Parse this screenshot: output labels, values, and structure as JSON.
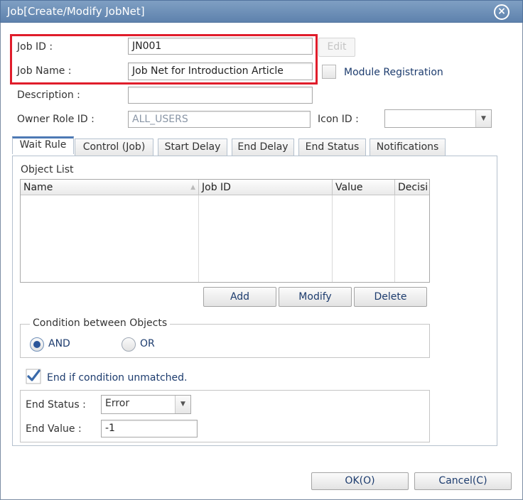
{
  "window": {
    "title": "Job[Create/Modify JobNet]",
    "close_icon": "close-circle-icon"
  },
  "form": {
    "job_id_label": "Job ID :",
    "job_id_value": "JN001",
    "edit_label": "Edit",
    "job_name_label": "Job Name :",
    "job_name_value": "Job Net for Introduction Article",
    "module_registration_label": "Module Registration",
    "description_label": "Description :",
    "description_value": "",
    "owner_role_label": "Owner Role ID :",
    "owner_role_value": "ALL_USERS",
    "icon_id_label": "Icon ID :",
    "icon_id_value": ""
  },
  "tabs": [
    {
      "label": "Wait Rule"
    },
    {
      "label": "Control (Job)"
    },
    {
      "label": "Start Delay"
    },
    {
      "label": "End Delay"
    },
    {
      "label": "End Status"
    },
    {
      "label": "Notifications"
    }
  ],
  "active_tab": "Wait Rule",
  "wait_rule": {
    "object_list_label": "Object List",
    "columns": [
      "Name",
      "Job ID",
      "Value",
      "Decisi"
    ],
    "rows": [],
    "add_label": "Add",
    "modify_label": "Modify",
    "delete_label": "Delete",
    "condition_legend": "Condition between Objects",
    "and_label": "AND",
    "or_label": "OR",
    "selected_condition": "AND",
    "end_if_unmatched_label": "End if condition unmatched.",
    "end_if_unmatched_checked": true,
    "end_status_label": "End Status :",
    "end_status_value": "Error",
    "end_value_label": "End Value :",
    "end_value_value": "-1"
  },
  "footer": {
    "ok_label": "OK(O)",
    "cancel_label": "Cancel(C)"
  },
  "colors": {
    "titlebar": "#6b8db6",
    "highlight_box": "#e01d2b",
    "tab_accent": "#4d79b4",
    "button_text": "#1d3c6e"
  }
}
